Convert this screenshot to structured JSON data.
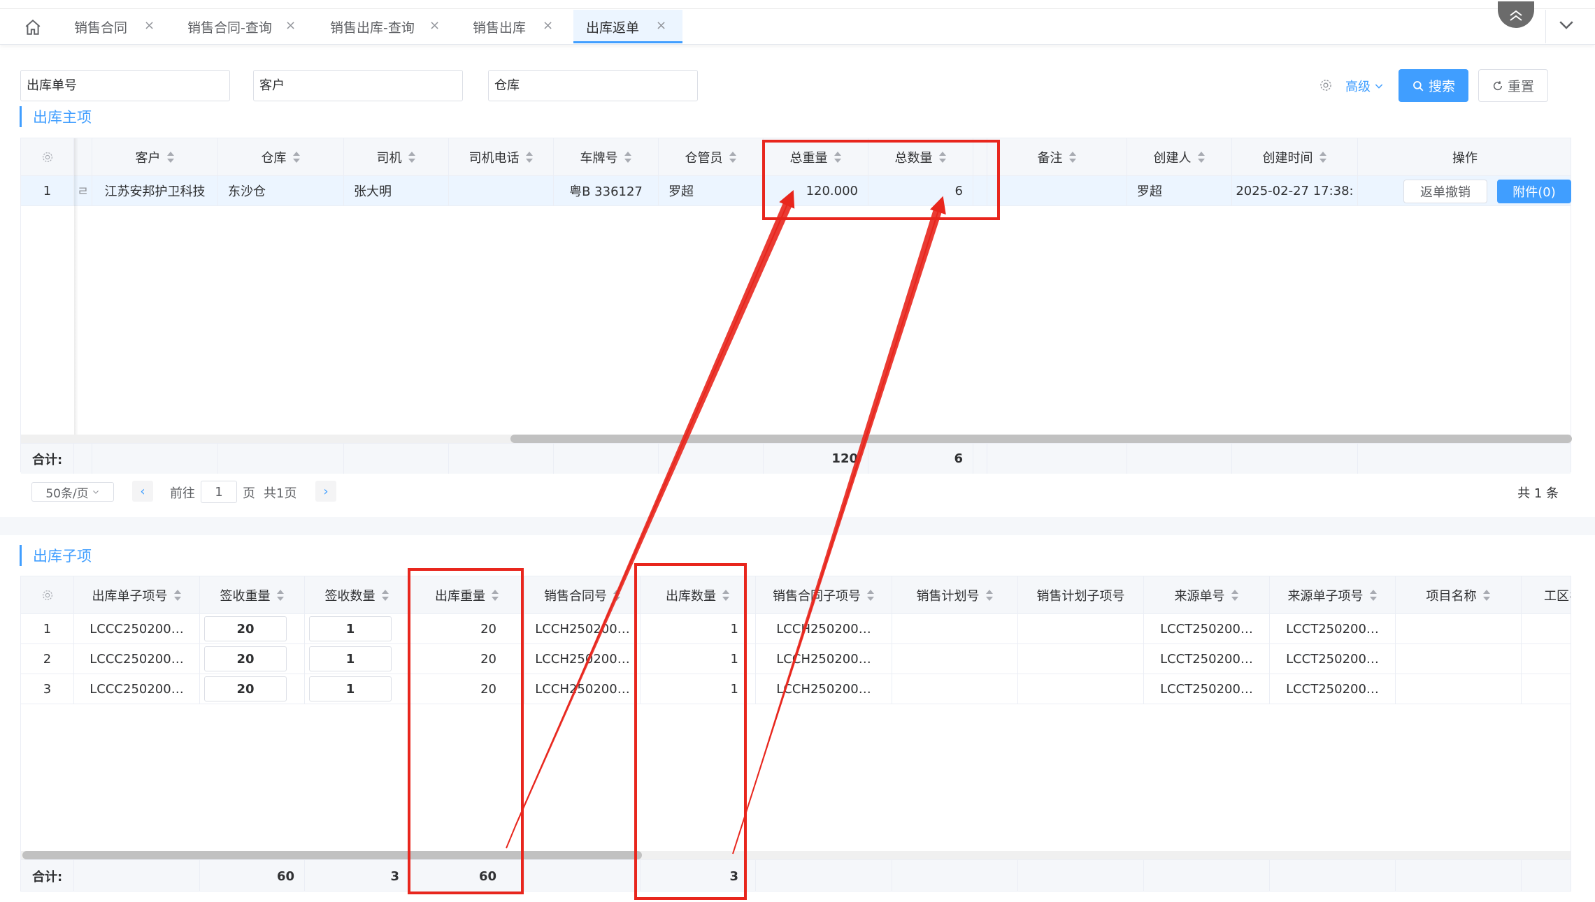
{
  "tabs": [
    {
      "label": "销售合同",
      "active": false
    },
    {
      "label": "销售合同-查询",
      "active": false
    },
    {
      "label": "销售出库-查询",
      "active": false
    },
    {
      "label": "销售出库",
      "active": false
    },
    {
      "label": "出库返单",
      "active": true
    }
  ],
  "close_glyph": "×",
  "search": {
    "order_no_placeholder": "出库单号",
    "customer_placeholder": "客户",
    "warehouse_placeholder": "仓库",
    "advanced_label": "高级",
    "search_label": "搜索",
    "reset_label": "重置"
  },
  "main_section": {
    "title": "出库主项",
    "headers": [
      "客户",
      "仓库",
      "司机",
      "司机电话",
      "车牌号",
      "仓管员",
      "总重量",
      "总数量",
      "备注",
      "创建人",
      "创建时间",
      "操作"
    ],
    "rows": [
      {
        "index": "1",
        "cut_prefix": "ㄹ",
        "customer": "江苏安邦护卫科技",
        "warehouse": "东沙仓",
        "driver": "张大明",
        "driver_phone": "",
        "plate": "粤B 336127",
        "keeper": "罗超",
        "total_weight": "120.000",
        "total_qty": "6",
        "remark": "",
        "creator": "罗超",
        "created_at": "2025-02-27 17:38:",
        "op_revoke": "返单撤销",
        "op_attach": "附件(0)"
      }
    ],
    "footer_label": "合计:",
    "footer_weight": "120",
    "footer_qty": "6"
  },
  "pager": {
    "page_size": "50条/页",
    "goto_label": "前往",
    "page_value": "1",
    "page_unit": "页",
    "total_pages": "共1页",
    "total_items": "共 1 条",
    "prev": "‹",
    "next": "›"
  },
  "sub_section": {
    "title": "出库子项",
    "headers": [
      "出库单子项号",
      "签收重量",
      "签收数量",
      "出库重量",
      "销售合同号",
      "出库数量",
      "销售合同子项号",
      "销售计划号",
      "销售计划子项号",
      "来源单号",
      "来源单子项号",
      "项目名称",
      "工区名称"
    ],
    "rows": [
      {
        "index": "1",
        "sub_no": "LCCC250200…",
        "sign_weight": "20",
        "sign_qty": "1",
        "out_weight": "20",
        "contract_no": "LCCH250200…",
        "out_qty": "1",
        "contract_sub_no": "LCCH250200…",
        "plan_no": "",
        "plan_sub_no": "",
        "source_no": "LCCT250200…",
        "source_sub_no": "LCCT250200…",
        "project": "",
        "area": ""
      },
      {
        "index": "2",
        "sub_no": "LCCC250200…",
        "sign_weight": "20",
        "sign_qty": "1",
        "out_weight": "20",
        "contract_no": "LCCH250200…",
        "out_qty": "1",
        "contract_sub_no": "LCCH250200…",
        "plan_no": "",
        "plan_sub_no": "",
        "source_no": "LCCT250200…",
        "source_sub_no": "LCCT250200…",
        "project": "",
        "area": ""
      },
      {
        "index": "3",
        "sub_no": "LCCC250200…",
        "sign_weight": "20",
        "sign_qty": "1",
        "out_weight": "20",
        "contract_no": "LCCH250200…",
        "out_qty": "1",
        "contract_sub_no": "LCCH250200…",
        "plan_no": "",
        "plan_sub_no": "",
        "source_no": "LCCT250200…",
        "source_sub_no": "LCCT250200…",
        "project": "",
        "area": ""
      }
    ],
    "footer_label": "合计:",
    "footer_sign_weight": "60",
    "footer_sign_qty": "3",
    "footer_out_weight": "60",
    "footer_out_qty": "3"
  },
  "colors": {
    "accent": "#409eff",
    "annotation": "#e8261d"
  },
  "icons": {
    "home": "home-icon",
    "search": "search-icon",
    "reset": "refresh-icon",
    "gear": "gear-icon",
    "collapse": "double-chevron-up-icon",
    "dropdown": "chevron-down-icon"
  }
}
